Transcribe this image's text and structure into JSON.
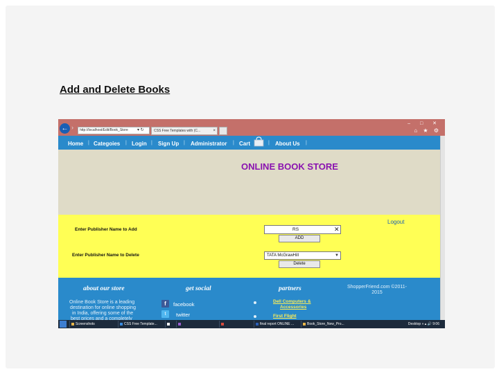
{
  "slide": {
    "title": "Add and Delete Books"
  },
  "browser": {
    "address": "http://localhost/Edit/Book_Store",
    "address_icons": "▾ ↻",
    "tab_title": "CSS Free Templates with (C...",
    "window_controls": "– □ ✕",
    "tools": "⌂ ★ ⚙"
  },
  "nav": {
    "items": [
      {
        "label": "Home"
      },
      {
        "label": "Categoies"
      },
      {
        "label": "Login"
      },
      {
        "label": "Sign Up"
      },
      {
        "label": "Administrator"
      },
      {
        "label": "Cart"
      },
      {
        "label": "About Us"
      }
    ],
    "separator": "|"
  },
  "header": {
    "store_title": "ONLINE BOOK STORE"
  },
  "form": {
    "logout": "Logout",
    "add_label": "Enter Publisher Name to Add",
    "add_value": "RS",
    "add_button": "ADD",
    "delete_label": "Enter Publisher Name to Delete",
    "delete_selected": "TATA McGrawHill",
    "delete_button": "Delete"
  },
  "footer": {
    "about_head": "about our store",
    "about_text_lines": [
      "Online Book Store is a leading",
      "destination for online shopping",
      "in India, offering some of the",
      "best prices and a completely"
    ],
    "social_head": "get social",
    "facebook": "facebook",
    "twitter": "twitter",
    "partners_head": "partners",
    "partner_1": "Dell Computers &",
    "partner_1b": "Accessories",
    "partner_2": "First Flight",
    "copyright_line1": "ShopperFriend.com     ©2011-",
    "copyright_line2": "2015"
  },
  "taskbar": {
    "items": [
      {
        "label": "Screenshots"
      },
      {
        "label": "CSS Free Template..."
      },
      {
        "label": ""
      },
      {
        "label": ""
      },
      {
        "label": ""
      },
      {
        "label": "final report ONLINE ..."
      },
      {
        "label": "Book_Store_New_Pro..."
      }
    ],
    "tray": "Desktop  »  ▴ 🔊  9:06"
  },
  "colors": {
    "chrome": "#c4706a",
    "nav": "#2a8acb",
    "banner": "#dfdbc7",
    "form_bg": "#ffff55",
    "store_title": "#8a12b0",
    "partner_link": "#ffee55"
  }
}
